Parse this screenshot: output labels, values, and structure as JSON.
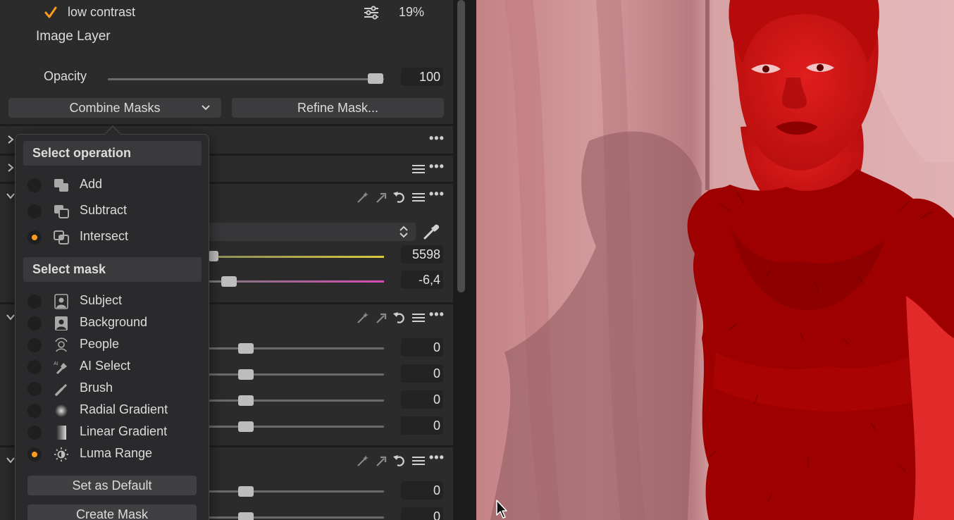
{
  "layer": {
    "mask_name": "low contrast",
    "mask_checked": true,
    "mask_percent": "19%",
    "title": "Image Layer"
  },
  "opacity": {
    "label": "Opacity",
    "value": "100",
    "level": 1.0
  },
  "buttons": {
    "combine": "Combine Masks",
    "refine": "Refine Mask..."
  },
  "wb": {
    "temp_value": "5598",
    "tint_value": "-6,4"
  },
  "sliders": [
    {
      "value": "0"
    },
    {
      "value": "0"
    },
    {
      "value": "0"
    },
    {
      "value": "0"
    },
    {
      "value": "0"
    },
    {
      "value": "0"
    }
  ],
  "popup": {
    "operation_header": "Select operation",
    "operations": [
      {
        "label": "Add",
        "selected": false,
        "icon": "add-mask-icon"
      },
      {
        "label": "Subtract",
        "selected": false,
        "icon": "subtract-mask-icon"
      },
      {
        "label": "Intersect",
        "selected": true,
        "icon": "intersect-mask-icon"
      }
    ],
    "mask_header": "Select mask",
    "masks": [
      {
        "label": "Subject",
        "selected": false,
        "icon": "subject-icon"
      },
      {
        "label": "Background",
        "selected": false,
        "icon": "background-icon"
      },
      {
        "label": "People",
        "selected": false,
        "icon": "people-icon"
      },
      {
        "label": "AI Select",
        "selected": false,
        "icon": "ai-select-icon"
      },
      {
        "label": "Brush",
        "selected": false,
        "icon": "brush-icon"
      },
      {
        "label": "Radial Gradient",
        "selected": false,
        "icon": "radial-gradient-icon"
      },
      {
        "label": "Linear Gradient",
        "selected": false,
        "icon": "linear-gradient-icon"
      },
      {
        "label": "Luma Range",
        "selected": true,
        "icon": "luma-range-icon"
      }
    ],
    "default_button": "Set as Default",
    "create_button": "Create Mask"
  },
  "colors": {
    "accent": "#ff9a1c",
    "mask_overlay": "#d40000"
  }
}
